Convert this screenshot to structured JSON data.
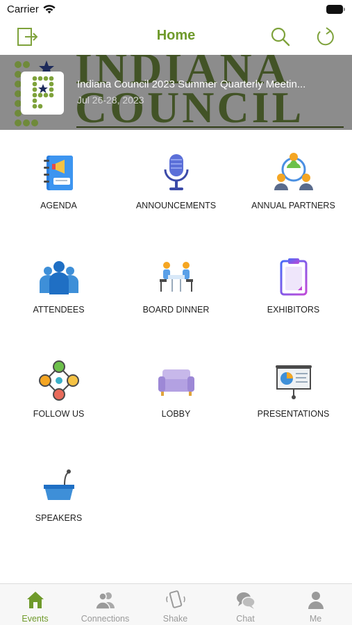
{
  "status": {
    "carrier": "Carrier"
  },
  "header": {
    "title": "Home"
  },
  "banner": {
    "event_title": "Indiana Council 2023 Summer Quarterly Meetin...",
    "event_dates": "Jul 26-28, 2023",
    "background_text": "INDIANA COUNCIL"
  },
  "tiles": [
    {
      "label": "AGENDA",
      "icon": "agenda-book-icon"
    },
    {
      "label": "ANNOUNCEMENTS",
      "icon": "microphone-icon"
    },
    {
      "label": "ANNUAL PARTNERS",
      "icon": "partners-icon"
    },
    {
      "label": "ATTENDEES",
      "icon": "attendees-icon"
    },
    {
      "label": "BOARD DINNER",
      "icon": "dinner-table-icon"
    },
    {
      "label": "EXHIBITORS",
      "icon": "clipboard-icon"
    },
    {
      "label": "FOLLOW US",
      "icon": "network-icon"
    },
    {
      "label": "LOBBY",
      "icon": "sofa-icon"
    },
    {
      "label": "PRESENTATIONS",
      "icon": "presentation-board-icon"
    },
    {
      "label": "SPEAKERS",
      "icon": "podium-icon"
    }
  ],
  "tabs": [
    {
      "label": "Events",
      "icon": "home-icon",
      "active": true
    },
    {
      "label": "Connections",
      "icon": "people-icon"
    },
    {
      "label": "Shake",
      "icon": "shake-phone-icon"
    },
    {
      "label": "Chat",
      "icon": "chat-bubbles-icon"
    },
    {
      "label": "Me",
      "icon": "person-icon"
    }
  ],
  "colors": {
    "accent": "#6f9a2b",
    "banner_bg": "#8c8c8c",
    "tab_inactive": "#9a9a9a"
  }
}
